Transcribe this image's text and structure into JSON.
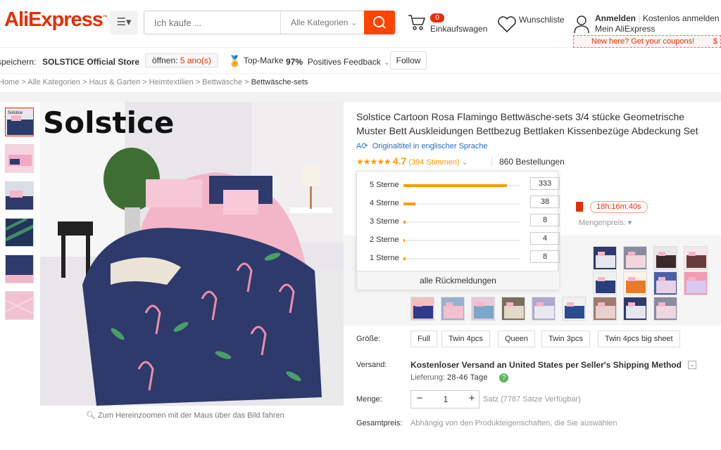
{
  "header": {
    "logo": "AliExpress",
    "search_placeholder": "Ich kaufe ...",
    "category_select": "Alle Kategorien",
    "cart_count": "0",
    "cart_label": "Einkaufswagen",
    "wishlist_label": "Wunschliste",
    "signin_label": "Anmelden",
    "register_label": "Kostenlos anmelden",
    "my_account_label": "Mein AliExpress",
    "coupon_banner": "New here? Get your coupons!",
    "coupon_extra": "$"
  },
  "store": {
    "save_label": "speichern:",
    "name": "SOLSTICE Official Store",
    "open_label": "öffnen:",
    "open_value": "5 ano(s)",
    "top_brand_label": "Top-Marke",
    "feedback_percent": "97%",
    "feedback_label": "Positives Feedback",
    "follow_label": "Follow"
  },
  "breadcrumb": {
    "items": [
      "Home",
      "Alle Kategorien",
      "Haus & Garten",
      "Heimtextilien",
      "Bettwäsche"
    ],
    "current": "Bettwäsche-sets",
    "sep": " > "
  },
  "gallery": {
    "brand_watermark": "Solstice",
    "zoom_hint": "Zum Hereinzoomen mit der Maus über das Bild fahren"
  },
  "product": {
    "title": "Solstice Cartoon Rosa Flamingo Bettwäsche-sets 3/4 stücke Geometrische Muster Bett Auskleidungen Bettbezug Bettlaken Kissenbezüge Abdeckung Set",
    "original_title_link": "Originaltitel in englischer Sprache",
    "rating_stars": "★★★★★",
    "rating_value": "4.7",
    "rating_votes": "(394 Stimmen)",
    "orders": "860 Bestellungen",
    "timer": "18h:16m:40s",
    "bulk_price_label": "Mengenpreis:"
  },
  "rating_popup": {
    "rows": [
      {
        "label": "5 Sterne",
        "count": "333",
        "fraction": 0.888
      },
      {
        "label": "4 Sterne",
        "count": "38",
        "fraction": 0.101
      },
      {
        "label": "3 Sterne",
        "count": "8",
        "fraction": 0.021
      },
      {
        "label": "2 Sterne",
        "count": "4",
        "fraction": 0.011
      },
      {
        "label": "1 Sterne",
        "count": "8",
        "fraction": 0.021
      }
    ],
    "all_reviews_label": "alle Rückmeldungen"
  },
  "options": {
    "size_label": "Größe:",
    "sizes": [
      "Full",
      "Twin 4pcs",
      "Queen",
      "Twin 3pcs",
      "Twin 4pcs big sheet"
    ],
    "shipping_label": "Versand:",
    "shipping_text": "Kostenloser Versand an United States per Seller's Shipping Method",
    "delivery_label": "Lieferung:",
    "delivery_value": "28-46 Tage",
    "quantity_label": "Menge:",
    "quantity_value": "1",
    "quantity_minus": "−",
    "quantity_plus": "+",
    "availability": "Satz (7787 Sätze Verfügbar)",
    "total_label": "Gesamtpreis:",
    "total_text": "Abhängig von den Produkteigenschaften, die Sie auswählen"
  },
  "colors": {
    "brand": "#e62e04",
    "search_button": "#ff4400",
    "star": "#ff9900",
    "link": "#2a6bc9"
  }
}
